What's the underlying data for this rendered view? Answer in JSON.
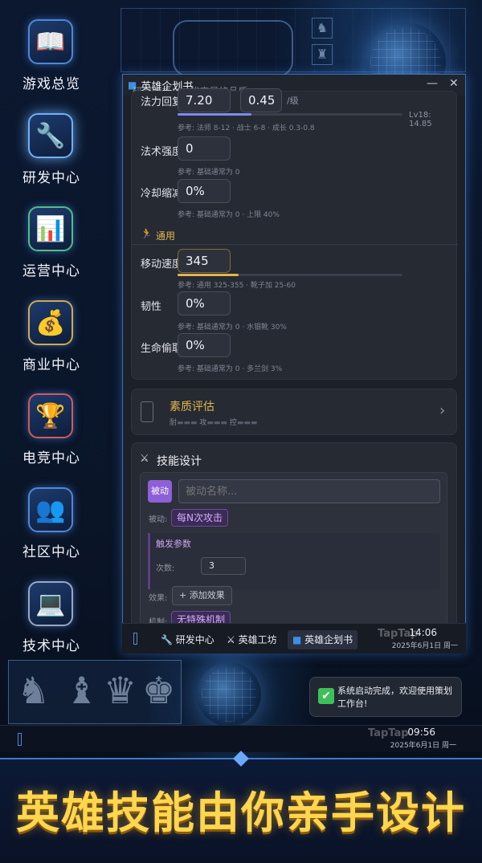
{
  "sidebar": {
    "items": [
      {
        "label": "游戏总览",
        "icon": "book-icon"
      },
      {
        "label": "研发中心",
        "icon": "wrench-icon"
      },
      {
        "label": "运营中心",
        "icon": "bar-chart-icon"
      },
      {
        "label": "商业中心",
        "icon": "money-bag-icon"
      },
      {
        "label": "电竞中心",
        "icon": "trophy-icon"
      },
      {
        "label": "社区中心",
        "icon": "users-icon"
      },
      {
        "label": "技术中心",
        "icon": "laptop-icon"
      }
    ]
  },
  "window": {
    "title": "英雄企划书",
    "ghost_text": "研发新主义 · 代表最终品质",
    "minimize": "—",
    "close": "✕",
    "stats": {
      "mana_regen": {
        "label": "法力回复",
        "value1": "7.20",
        "value2": "0.45",
        "unit": "/级",
        "level_note": "Lv18: 14.85",
        "hint": "参考: 法师 8-12 · 战士 6-8 · 成长 0.3-0.8",
        "bar_fraction": 0.33
      },
      "ability_power": {
        "label": "法术强度",
        "value": "0",
        "hint": "参考: 基础通常为 0"
      },
      "cooldown": {
        "label": "冷却缩减",
        "value": "0%",
        "hint": "参考: 基础通常为 0 · 上限 40%"
      },
      "general_title": "通用",
      "move_speed": {
        "label": "移动速度",
        "value": "345",
        "hint": "参考: 通用 325-355 · 靴子加 25-60",
        "bar_fraction": 0.27
      },
      "tenacity": {
        "label": "韧性",
        "value": "0%",
        "hint": "参考: 基础通常为 0 · 水银靴 30%"
      },
      "lifesteal": {
        "label": "生命偷取",
        "value": "0%",
        "hint": "参考: 基础通常为 0 · 多兰剑 3%"
      }
    },
    "quality": {
      "title": "素质评估",
      "sub": [
        "耐",
        "攻",
        "控"
      ],
      "chevron": "›"
    },
    "skills": {
      "title": "技能设计",
      "passive_tag": "被动",
      "name_placeholder": "被动名称...",
      "trigger_label": "被动:",
      "trigger_value": "每N次攻击",
      "params_title": "触发参数",
      "count_label": "次数:",
      "count_value": "3",
      "effect_label": "效果:",
      "add_effect": "+ 添加效果",
      "mechanic_label": "机制:",
      "mechanic_value": "无特殊机制"
    }
  },
  "taskbar": {
    "items": [
      "研发中心",
      "英雄工坊",
      "英雄企划书"
    ],
    "time": "14:06",
    "date": "2025年6月1日 周一",
    "watermark": "TapTap"
  },
  "notification": {
    "text": "系统启动完成，欢迎使用策划工作台!"
  },
  "bottom_bar": {
    "time": "09:56",
    "date": "2025年6月1日 周一",
    "watermark": "TapTap"
  },
  "banner": {
    "text": "英雄技能由你亲手设计"
  },
  "colors": {
    "accent_blue": "#3f78c9",
    "mana_bar": "#7b8cf0",
    "speed_bar": "#e3b64a",
    "passive_purple": "#8e5fd6",
    "banner_gold": "#ffd64d"
  }
}
